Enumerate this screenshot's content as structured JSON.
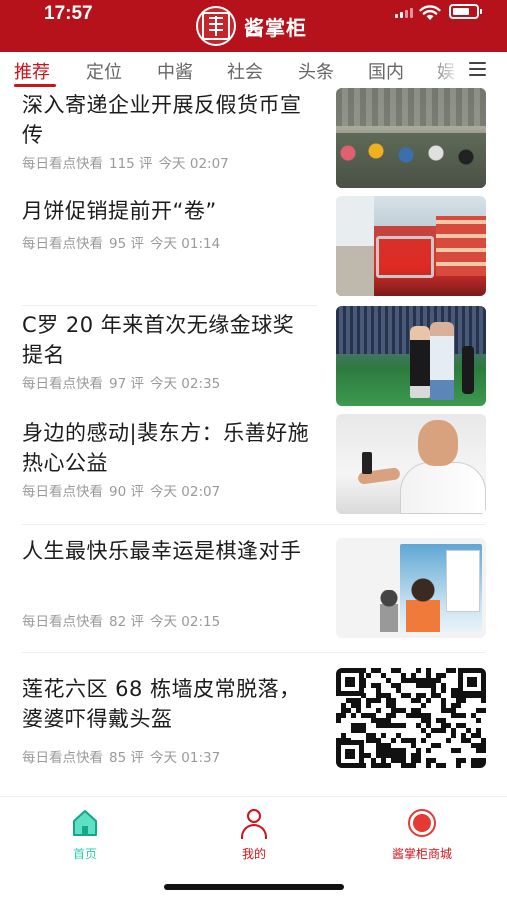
{
  "status_bar": {
    "time": "17:57"
  },
  "app": {
    "name": "酱掌柜",
    "brand_color": "#b5121b",
    "accent_color": "#d0121b"
  },
  "tabs": {
    "items": [
      {
        "label": "推荐",
        "active": true
      },
      {
        "label": "定位"
      },
      {
        "label": "中酱"
      },
      {
        "label": "社会"
      },
      {
        "label": "头条"
      },
      {
        "label": "国内"
      },
      {
        "label": "娱"
      }
    ]
  },
  "feed": {
    "items": [
      {
        "title": "深入寄递企业开展反假货币宣传",
        "source": "每日看点快看",
        "comments": "115 评",
        "time": "今天 02:07"
      },
      {
        "title": "月饼促销提前开“卷”",
        "source": "每日看点快看",
        "comments": "95 评",
        "time": "今天 01:14"
      },
      {
        "title": "C罗 20 年来首次无缘金球奖提名",
        "source": "每日看点快看",
        "comments": "97 评",
        "time": "今天 02:35"
      },
      {
        "title": "身边的感动|裴东方：乐善好施 热心公益",
        "source": "每日看点快看",
        "comments": "90 评",
        "time": "今天 02:07"
      },
      {
        "title": "人生最快乐最幸运是棋逢对手",
        "source": "每日看点快看",
        "comments": "82 评",
        "time": "今天 02:15"
      },
      {
        "title": "莲花六区 68 栋墙皮常脱落，婆婆吓得戴头盔",
        "source": "每日看点快看",
        "comments": "85 评",
        "time": "今天 01:37"
      }
    ]
  },
  "bottom_nav": {
    "items": [
      {
        "label": "首页",
        "icon": "home-icon",
        "color": "#2ccfae"
      },
      {
        "label": "我的",
        "icon": "person-icon",
        "color": "#d0121b"
      },
      {
        "label": "酱掌柜商城",
        "icon": "record-icon",
        "color": "#d0121b"
      }
    ]
  }
}
